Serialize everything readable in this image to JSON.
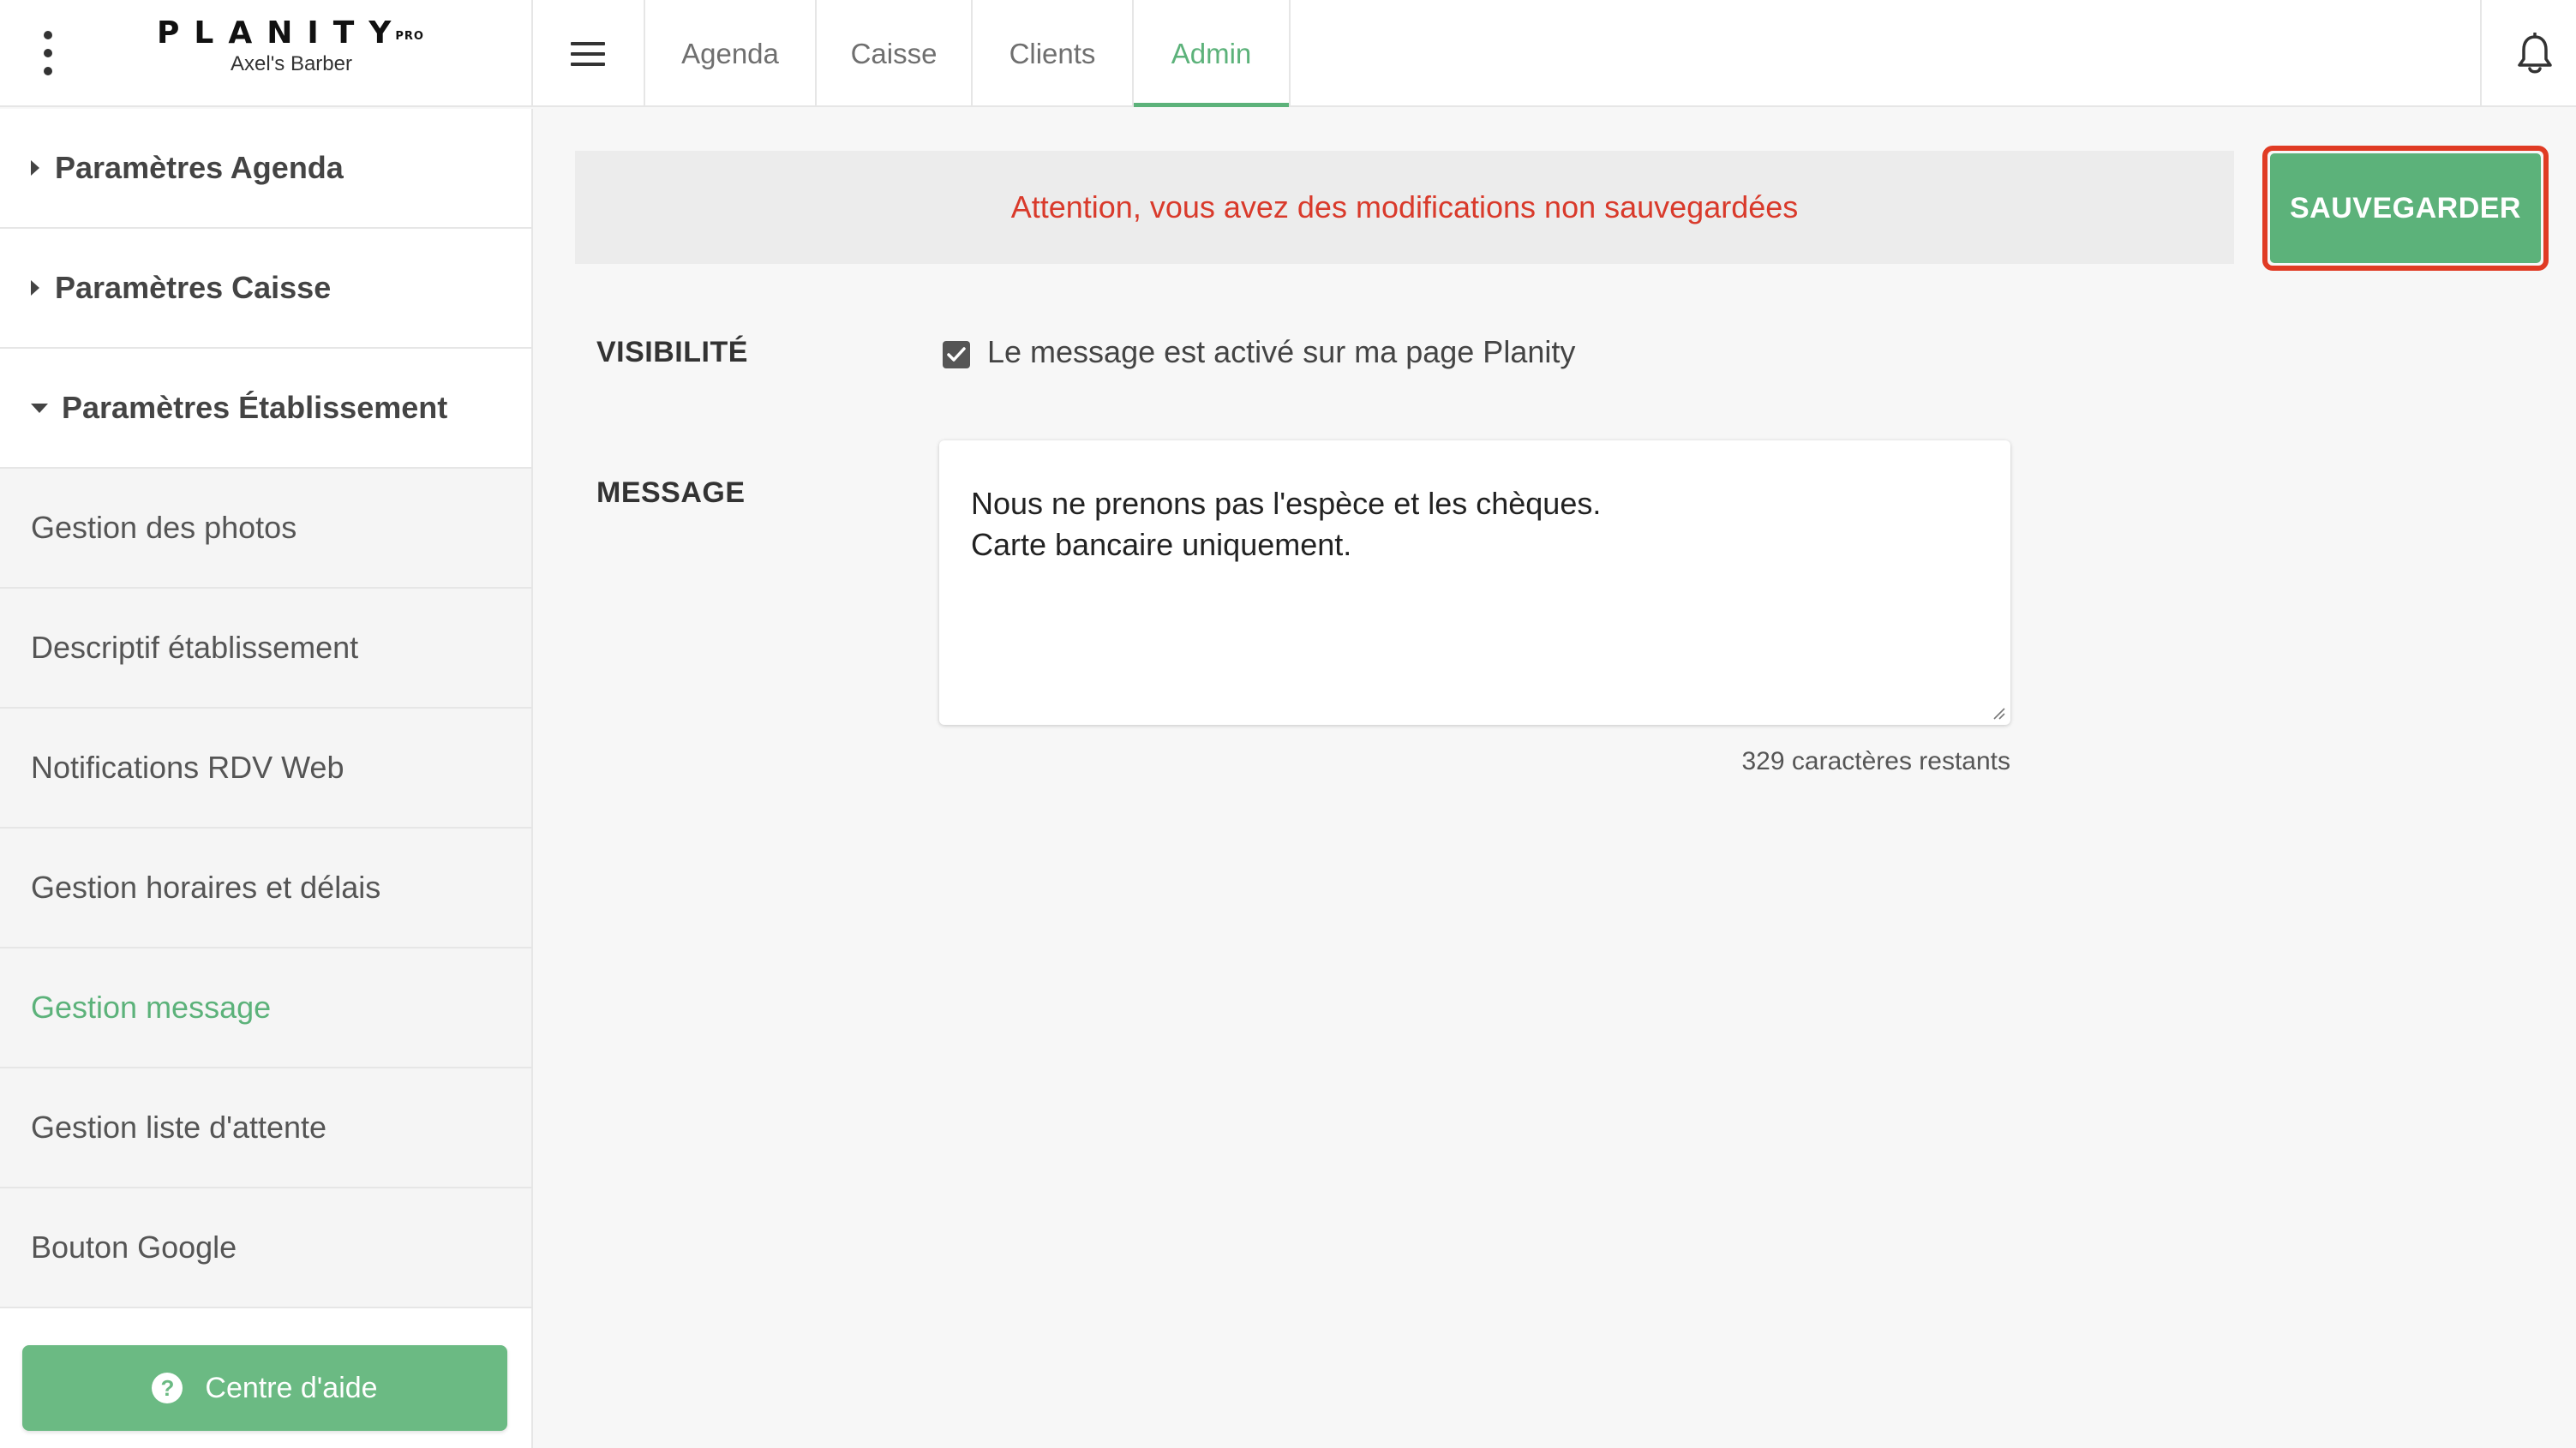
{
  "brand": {
    "logo_text": "PLANITY",
    "logo_suffix": "PRO",
    "salon_name": "Axel's Barber"
  },
  "icons": {
    "menu_dots": "kebab-vertical-icon",
    "hamburger": "hamburger-menu-icon",
    "notifications": "bell-icon",
    "help": "question-circle-icon",
    "checkbox": "checkmark-icon",
    "collapsed": "caret-right-icon",
    "expanded": "caret-down-icon"
  },
  "tabs": [
    {
      "label": "Agenda",
      "active": false
    },
    {
      "label": "Caisse",
      "active": false
    },
    {
      "label": "Clients",
      "active": false
    },
    {
      "label": "Admin",
      "active": true
    }
  ],
  "sidebar": {
    "sections": [
      {
        "label": "Paramètres Agenda",
        "expanded": false
      },
      {
        "label": "Paramètres Caisse",
        "expanded": false
      },
      {
        "label": "Paramètres Établissement",
        "expanded": true
      }
    ],
    "items": [
      {
        "label": "Gestion des photos",
        "active": false
      },
      {
        "label": "Descriptif établissement",
        "active": false
      },
      {
        "label": "Notifications RDV Web",
        "active": false
      },
      {
        "label": "Gestion horaires et délais",
        "active": false
      },
      {
        "label": "Gestion message",
        "active": true
      },
      {
        "label": "Gestion liste d'attente",
        "active": false
      },
      {
        "label": "Bouton Google",
        "active": false
      }
    ],
    "help_button": "Centre d'aide"
  },
  "main": {
    "warning": "Attention, vous avez des modifications non sauvegardées",
    "save_button": "SAUVEGARDER",
    "visibility": {
      "label": "VISIBILITÉ",
      "checkbox_label": "Le message est activé sur ma page Planity",
      "checked": true
    },
    "message": {
      "label": "MESSAGE",
      "line1": "Nous ne prenons pas l'espèce et les chèques.",
      "line2": "Carte bancaire uniquement.",
      "counter": "329 caractères restants"
    }
  },
  "colors": {
    "accent": "#5cb27a",
    "warning_text": "#d93a2b",
    "highlight_border": "#e03b24",
    "help_button": "#6bba83"
  }
}
